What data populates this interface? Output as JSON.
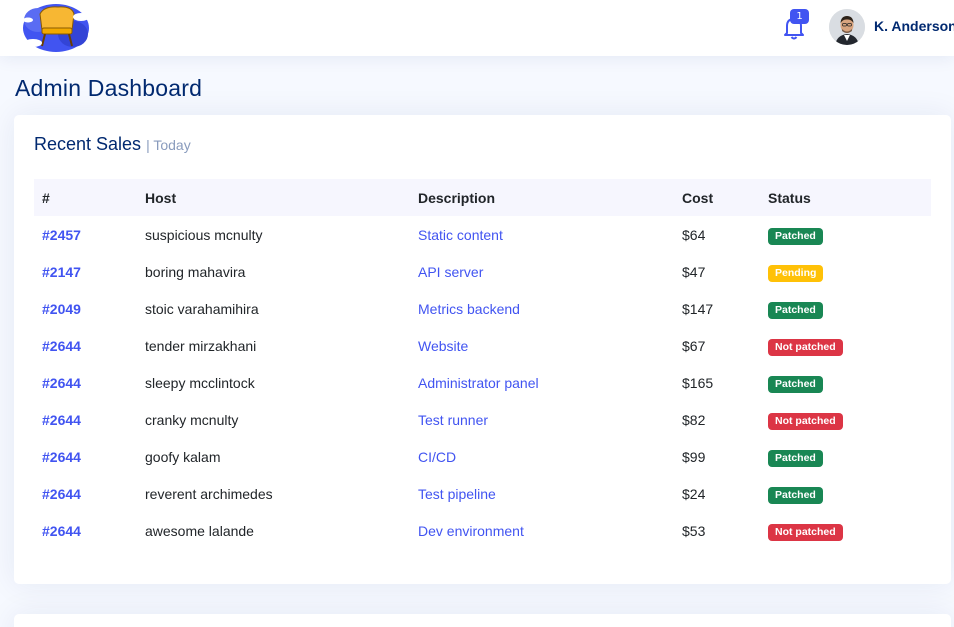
{
  "header": {
    "notification_count": "1",
    "username": "K. Anderson"
  },
  "page": {
    "title": "Admin Dashboard"
  },
  "recent_sales": {
    "title": "Recent Sales",
    "subtitle": "| Today",
    "columns": [
      "#",
      "Host",
      "Description",
      "Cost",
      "Status"
    ],
    "rows": [
      {
        "id": "#2457",
        "host": "suspicious mcnulty",
        "description": "Static content",
        "cost": "$64",
        "status": "Patched",
        "status_color": "#198754"
      },
      {
        "id": "#2147",
        "host": "boring mahavira",
        "description": "API server",
        "cost": "$47",
        "status": "Pending",
        "status_color": "#ffc107"
      },
      {
        "id": "#2049",
        "host": "stoic varahamihira",
        "description": "Metrics backend",
        "cost": "$147",
        "status": "Patched",
        "status_color": "#198754"
      },
      {
        "id": "#2644",
        "host": "tender mirzakhani",
        "description": "Website",
        "cost": "$67",
        "status": "Not patched",
        "status_color": "#dc3545"
      },
      {
        "id": "#2644",
        "host": "sleepy mcclintock",
        "description": "Administrator panel",
        "cost": "$165",
        "status": "Patched",
        "status_color": "#198754"
      },
      {
        "id": "#2644",
        "host": "cranky mcnulty",
        "description": "Test runner",
        "cost": "$82",
        "status": "Not patched",
        "status_color": "#dc3545"
      },
      {
        "id": "#2644",
        "host": "goofy kalam",
        "description": "CI/CD",
        "cost": "$99",
        "status": "Patched",
        "status_color": "#198754"
      },
      {
        "id": "#2644",
        "host": "reverent archimedes",
        "description": "Test pipeline",
        "cost": "$24",
        "status": "Patched",
        "status_color": "#198754"
      },
      {
        "id": "#2644",
        "host": "awesome lalande",
        "description": "Dev environment",
        "cost": "$53",
        "status": "Not patched",
        "status_color": "#dc3545"
      }
    ]
  }
}
